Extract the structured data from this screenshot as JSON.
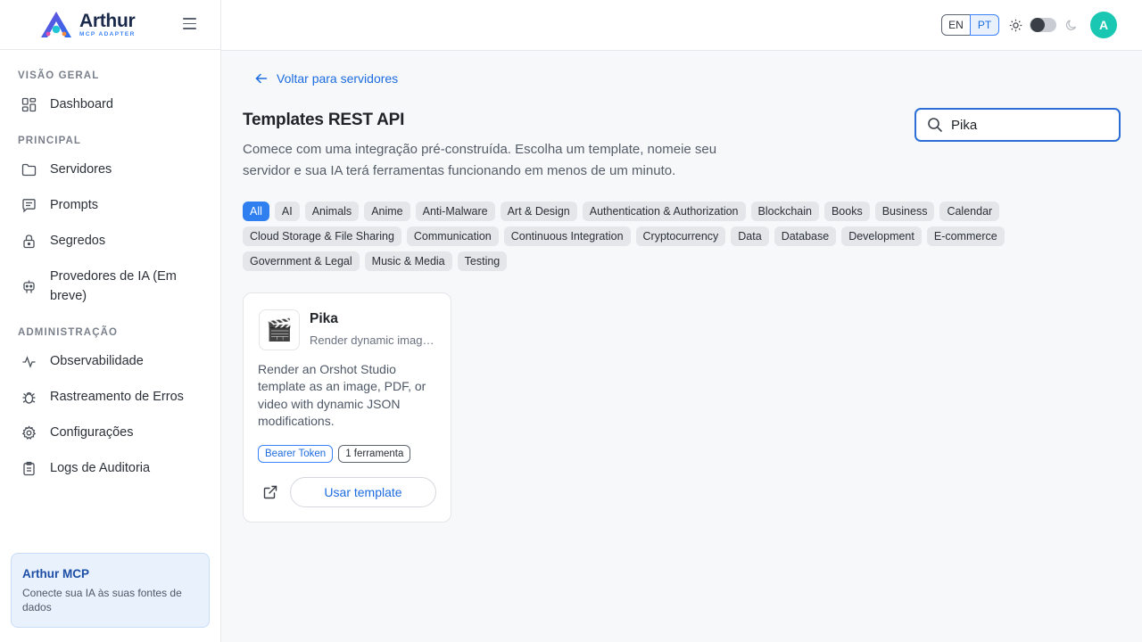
{
  "brand": {
    "name": "Arthur",
    "subtitle": "MCP ADAPTER"
  },
  "sidebar": {
    "sections": [
      {
        "title": "VISÃO GERAL"
      },
      {
        "title": "PRINCIPAL"
      },
      {
        "title": "ADMINISTRAÇÃO"
      }
    ],
    "items": [
      {
        "label": "Dashboard",
        "icon": "dashboard-icon"
      },
      {
        "label": "Servidores",
        "icon": "folder-icon"
      },
      {
        "label": "Prompts",
        "icon": "message-icon"
      },
      {
        "label": "Segredos",
        "icon": "lock-icon"
      },
      {
        "label": "Provedores de IA (Em breve)",
        "icon": "bot-icon"
      },
      {
        "label": "Observabilidade",
        "icon": "activity-icon"
      },
      {
        "label": "Rastreamento de Erros",
        "icon": "bug-icon"
      },
      {
        "label": "Configurações",
        "icon": "gear-icon"
      },
      {
        "label": "Logs de Auditoria",
        "icon": "clipboard-icon"
      }
    ],
    "promo": {
      "title": "Arthur MCP",
      "text": "Conecte sua IA às suas fontes de dados"
    }
  },
  "topbar": {
    "lang_en": "EN",
    "lang_pt": "PT",
    "selected_lang": "PT",
    "theme": "light",
    "avatar_initial": "A"
  },
  "main": {
    "back_label": "Voltar para servidores",
    "title": "Templates REST API",
    "description": "Comece com uma integração pré-construída. Escolha um template, nomeie seu servidor e sua IA terá ferramentas funcionando em menos de um minuto.",
    "search_value": "Pika",
    "categories": [
      "All",
      "AI",
      "Animals",
      "Anime",
      "Anti-Malware",
      "Art & Design",
      "Authentication & Authorization",
      "Blockchain",
      "Books",
      "Business",
      "Calendar",
      "Cloud Storage & File Sharing",
      "Communication",
      "Continuous Integration",
      "Cryptocurrency",
      "Data",
      "Database",
      "Development",
      "E-commerce",
      "Government & Legal",
      "Music & Media",
      "Testing"
    ],
    "active_category": "All",
    "card": {
      "icon": "🎬",
      "name": "Pika",
      "subtitle": "Render dynamic images...",
      "description": "Render an Orshot Studio template as an image, PDF, or video with dynamic JSON modifications.",
      "auth_badge": "Bearer Token",
      "tools_badge": "1 ferramenta",
      "use_label": "Usar template"
    }
  },
  "colors": {
    "accent": "#2f7ff0",
    "avatar": "#19c7b3",
    "brand_dark": "#1b2a4a"
  }
}
